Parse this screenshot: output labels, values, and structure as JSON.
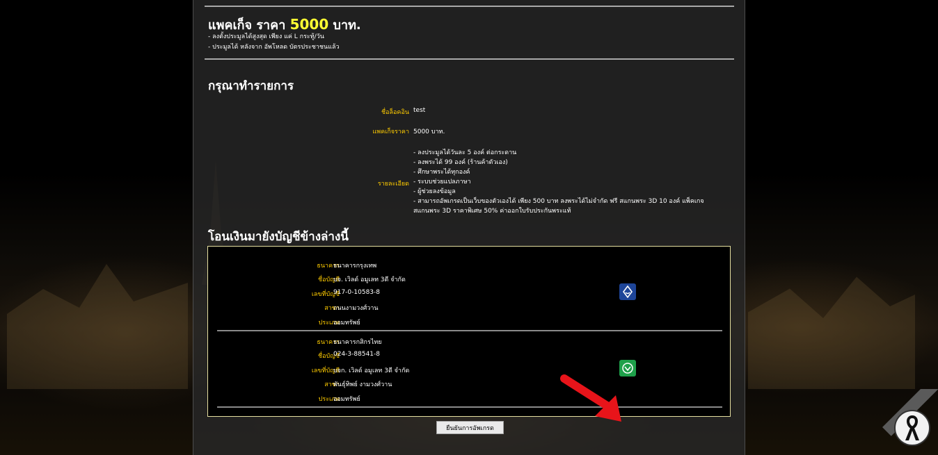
{
  "package": {
    "title_prefix": "แพคเก็จ ราคา",
    "price": "5000",
    "title_suffix": "บาท.",
    "notes": [
      "- ลงตั้งประมูลได้สูงสุด เพียง แค่ L กระทู้/วัน",
      "- ประมูลได้ หลังจาก อัพโหลด บัตรประชาชนแล้ว"
    ]
  },
  "form": {
    "heading": "กรุณาทำรายการ",
    "login_label": "ชื่อล็อคอิน",
    "login_value": "test",
    "package_label": "แพคเก็จราคา",
    "package_value": "5000 บาท.",
    "details_label": "รายละเอียด",
    "details": [
      "- ลงประมูลได้วันละ 5 องค์ ต่อกระดาน",
      "- ลงพระได้ 99 องค์ (ร้านค้าตัวเอง)",
      "- ศึกษาพระได้ทุกองค์",
      "- ระบบช่วยแปลภาษา",
      "- ผู้ช่วยลงข้อมูล",
      "- สามารถอัพเกรดเป็นเว็บของตัวเองได้ เพียง 500 บาท ลงพระได้ไม่จำกัด ฟรี สแกนพระ 3D 10 องค์ แพ็คเกจ",
      "สแกนพระ 3D ราคาพิเศษ 50% ค่าออกใบรับประกันพระแท้"
    ]
  },
  "transfer": {
    "heading": "โอนเงินมายังบัญชีข้างล่างนี้",
    "banks": [
      {
        "bank_label": "ธนาคาร",
        "bank_value": "ธนาคารกรุงเทพ",
        "name_label": "ชื่อบัญชี",
        "name_value": "บจ. เวิลด์ อมูเลท 3ดี จำกัด",
        "number_label": "เลขที่บัญชี",
        "number_value": "917-0-10583-8",
        "branch_label": "สาขา",
        "branch_value": "ถนนงามวงศ์วาน",
        "type_label": "ประเภท",
        "type_value": "ออมทรัพย์",
        "logo_icon": "bangkok-bank-icon",
        "logo_color": "#1e4598"
      },
      {
        "bank_label": "ธนาคาร",
        "bank_value": "ธนาคารกสิกรไทย",
        "name_label": "ชื่อบัญชี",
        "name_value": "024-3-88541-8",
        "number_label": "เลขที่บัญชี",
        "number_value": "บจก. เวิลด์ อมูเลท 3ดี จำกัด",
        "branch_label": "สาขา",
        "branch_value": "พันธุ์ทิพย์ งามวงศ์วาน",
        "type_label": "ประเภท",
        "type_value": "ออมทรัพย์",
        "logo_icon": "kasikorn-bank-icon",
        "logo_color": "#1ea04a"
      }
    ]
  },
  "submit_label": "ยืนยันการอัพเกรด",
  "colors": {
    "label": "#ffcc00",
    "price": "#ffff33",
    "arrow": "#e8141a"
  }
}
